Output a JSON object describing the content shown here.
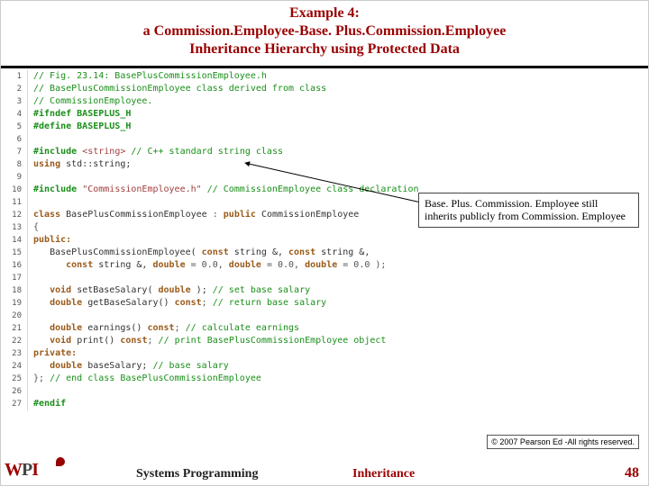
{
  "title": {
    "l1": "Example 4:",
    "l2": "a Commission.Employee-Base. Plus.Commission.Employee",
    "l3": "Inheritance Hierarchy using Protected Data"
  },
  "code": [
    {
      "n": "1",
      "cls": "c-comment",
      "t": "// Fig. 23.14: BasePlusCommissionEmployee.h"
    },
    {
      "n": "2",
      "cls": "c-comment",
      "t": "// BasePlusCommissionEmployee class derived from class"
    },
    {
      "n": "3",
      "cls": "c-comment",
      "t": "// CommissionEmployee."
    },
    {
      "n": "4",
      "cls": "c-pp",
      "t": "#ifndef BASEPLUS_H"
    },
    {
      "n": "5",
      "cls": "c-pp",
      "t": "#define BASEPLUS_H"
    },
    {
      "n": "6",
      "cls": "",
      "t": ""
    },
    {
      "n": "7",
      "cls": "mix",
      "t": "<span class='c-pp'>#include</span> <span class='c-str'>&lt;string&gt;</span> <span class='c-comment'>// C++ standard string class</span>"
    },
    {
      "n": "8",
      "cls": "mix",
      "t": "<span class='c-dk'>using</span> <span class='c-id'>std::string;</span>"
    },
    {
      "n": "9",
      "cls": "",
      "t": ""
    },
    {
      "n": "10",
      "cls": "mix",
      "t": "<span class='c-pp'>#include</span> <span class='c-str'>\"CommissionEmployee.h\"</span> <span class='c-comment'>// CommissionEmployee class declaration</span>"
    },
    {
      "n": "11",
      "cls": "",
      "t": ""
    },
    {
      "n": "12",
      "cls": "mix",
      "t": "<span class='c-dk'>class</span> <span class='c-id'>BasePlusCommissionEmployee</span> <span class='c-op'>:</span> <span class='c-dk'>public</span> <span class='c-id'>CommissionEmployee</span>"
    },
    {
      "n": "13",
      "cls": "c-op",
      "t": "{"
    },
    {
      "n": "14",
      "cls": "c-dk",
      "t": "public:"
    },
    {
      "n": "15",
      "cls": "mix",
      "t": "   <span class='c-id'>BasePlusCommissionEmployee(</span> <span class='c-dk'>const</span> <span class='c-id'>string &amp;,</span> <span class='c-dk'>const</span> <span class='c-id'>string &amp;,</span>"
    },
    {
      "n": "16",
      "cls": "mix",
      "t": "      <span class='c-dk'>const</span> <span class='c-id'>string &amp;,</span> <span class='c-dk'>double</span> <span class='c-op'>= 0.0,</span> <span class='c-dk'>double</span> <span class='c-op'>= 0.0,</span> <span class='c-dk'>double</span> <span class='c-op'>= 0.0 );</span>"
    },
    {
      "n": "17",
      "cls": "",
      "t": ""
    },
    {
      "n": "18",
      "cls": "mix",
      "t": "   <span class='c-dk'>void</span> <span class='c-id'>setBaseSalary(</span> <span class='c-dk'>double</span> <span class='c-id'>);</span> <span class='c-comment'>// set base salary</span>"
    },
    {
      "n": "19",
      "cls": "mix",
      "t": "   <span class='c-dk'>double</span> <span class='c-id'>getBaseSalary()</span> <span class='c-dk'>const</span><span class='c-op'>;</span> <span class='c-comment'>// return base salary</span>"
    },
    {
      "n": "20",
      "cls": "",
      "t": ""
    },
    {
      "n": "21",
      "cls": "mix",
      "t": "   <span class='c-dk'>double</span> <span class='c-id'>earnings()</span> <span class='c-dk'>const</span><span class='c-op'>;</span> <span class='c-comment'>// calculate earnings</span>"
    },
    {
      "n": "22",
      "cls": "mix",
      "t": "   <span class='c-dk'>void</span> <span class='c-id'>print()</span> <span class='c-dk'>const</span><span class='c-op'>;</span> <span class='c-comment'>// print BasePlusCommissionEmployee object</span>"
    },
    {
      "n": "23",
      "cls": "c-dk",
      "t": "private:"
    },
    {
      "n": "24",
      "cls": "mix",
      "t": "   <span class='c-dk'>double</span> <span class='c-id'>baseSalary;</span> <span class='c-comment'>// base salary</span>"
    },
    {
      "n": "25",
      "cls": "mix",
      "t": "<span class='c-op'>};</span> <span class='c-comment'>// end class BasePlusCommissionEmployee</span>"
    },
    {
      "n": "26",
      "cls": "",
      "t": ""
    },
    {
      "n": "27",
      "cls": "c-pp",
      "t": "#endif"
    }
  ],
  "note": "Base. Plus. Commission. Employee still inherits publicly from Commission. Employee",
  "copyright": "© 2007 Pearson Ed -All rights reserved.",
  "footer": {
    "t1": "Systems Programming",
    "t2": "Inheritance",
    "page": "48"
  }
}
